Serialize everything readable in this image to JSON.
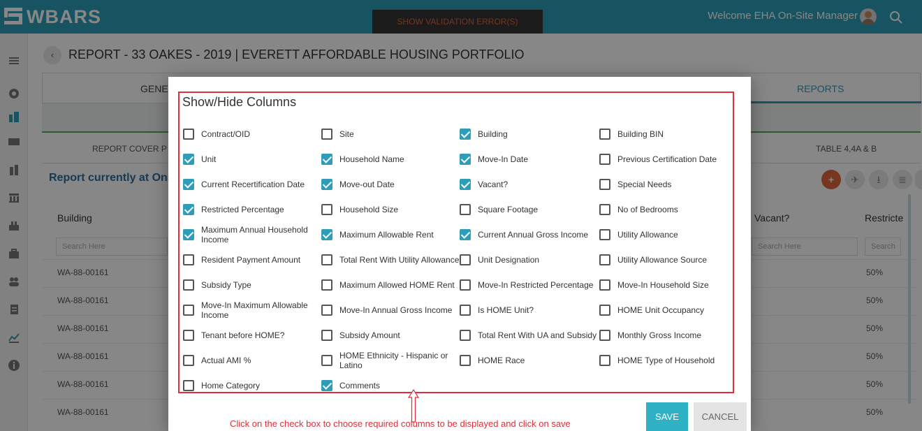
{
  "app": {
    "logo_text": "WBARS",
    "validation_label": "SHOW VALIDATION ERROR(S)",
    "welcome_text": "Welcome EHA On-Site Manager"
  },
  "colors": {
    "brand": "#2f9db8",
    "accent_orange": "#e0663d",
    "checkbox_checked": "#2f9db8",
    "highlight_red": "#e02f3a",
    "save_button": "#2fb1c6"
  },
  "page": {
    "title": "REPORT - 33 OAKES - 2019 | EVERETT AFFORDABLE HOUSING PORTFOLIO",
    "tab_general": "GENERA",
    "tab_reports": "REPORTS",
    "subtab_cover": "REPORT COVER P",
    "subtab_table": "TABLE 4,4A & B",
    "report_status": "Report currently at Ons",
    "columns": {
      "building": "Building",
      "vacant": "Vacant?",
      "restricted": "Restricte"
    },
    "search_placeholder": "Search Here",
    "search_placeholder_short": "Search",
    "rows": [
      {
        "bin": "WA-88-00161",
        "pct": "50%"
      },
      {
        "bin": "WA-88-00161",
        "pct": "50%"
      },
      {
        "bin": "WA-88-00161",
        "pct": "50%"
      },
      {
        "bin": "WA-88-00161",
        "pct": "50%"
      },
      {
        "bin": "WA-88-00161",
        "pct": "50%"
      },
      {
        "bin": "WA-88-00161",
        "pct": "50%"
      }
    ]
  },
  "modal": {
    "title": "Show/Hide Columns",
    "options": [
      {
        "label": "Contract/OID",
        "checked": false
      },
      {
        "label": "Site",
        "checked": false
      },
      {
        "label": "Building",
        "checked": true
      },
      {
        "label": "Building BIN",
        "checked": false
      },
      {
        "label": "Unit",
        "checked": true
      },
      {
        "label": "Household Name",
        "checked": true
      },
      {
        "label": "Move-In Date",
        "checked": true
      },
      {
        "label": "Previous Certification Date",
        "checked": false
      },
      {
        "label": "Current Recertification Date",
        "checked": true
      },
      {
        "label": "Move-out Date",
        "checked": true
      },
      {
        "label": "Vacant?",
        "checked": true
      },
      {
        "label": "Special Needs",
        "checked": false
      },
      {
        "label": "Restricted Percentage",
        "checked": true
      },
      {
        "label": "Household Size",
        "checked": false
      },
      {
        "label": "Square Footage",
        "checked": false
      },
      {
        "label": "No of Bedrooms",
        "checked": false
      },
      {
        "label": "Maximum Annual Household Income",
        "checked": true
      },
      {
        "label": "Maximum Allowable Rent",
        "checked": true
      },
      {
        "label": "Current Annual Gross Income",
        "checked": true
      },
      {
        "label": "Utility Allowance",
        "checked": false
      },
      {
        "label": "Resident Payment Amount",
        "checked": false
      },
      {
        "label": "Total Rent With Utility Allowance",
        "checked": false
      },
      {
        "label": "Unit Designation",
        "checked": false
      },
      {
        "label": "Utility Allowance Source",
        "checked": false
      },
      {
        "label": "Subsidy Type",
        "checked": false
      },
      {
        "label": "Maximum Allowed HOME Rent",
        "checked": false
      },
      {
        "label": "Move-In Restricted Percentage",
        "checked": false
      },
      {
        "label": "Move-In Household Size",
        "checked": false
      },
      {
        "label": "Move-In Maximum Allowable Income",
        "checked": false
      },
      {
        "label": "Move-In Annual Gross Income",
        "checked": false
      },
      {
        "label": "Is HOME Unit?",
        "checked": false
      },
      {
        "label": "HOME Unit Occupancy",
        "checked": false
      },
      {
        "label": "Tenant before HOME?",
        "checked": false
      },
      {
        "label": "Subsidy Amount",
        "checked": false
      },
      {
        "label": "Total Rent With UA and Subsidy",
        "checked": false
      },
      {
        "label": "Monthly Gross Income",
        "checked": false
      },
      {
        "label": "Actual AMI %",
        "checked": false
      },
      {
        "label": "HOME Ethnicity - Hispanic or Latino",
        "checked": false
      },
      {
        "label": "HOME Race",
        "checked": false
      },
      {
        "label": "HOME Type of Household",
        "checked": false
      },
      {
        "label": "Home Category",
        "checked": false
      },
      {
        "label": "Comments",
        "checked": true
      }
    ],
    "hint": "Click on the check box to choose required columns to be displayed and click on save",
    "save_label": "SAVE",
    "cancel_label": "CANCEL"
  }
}
